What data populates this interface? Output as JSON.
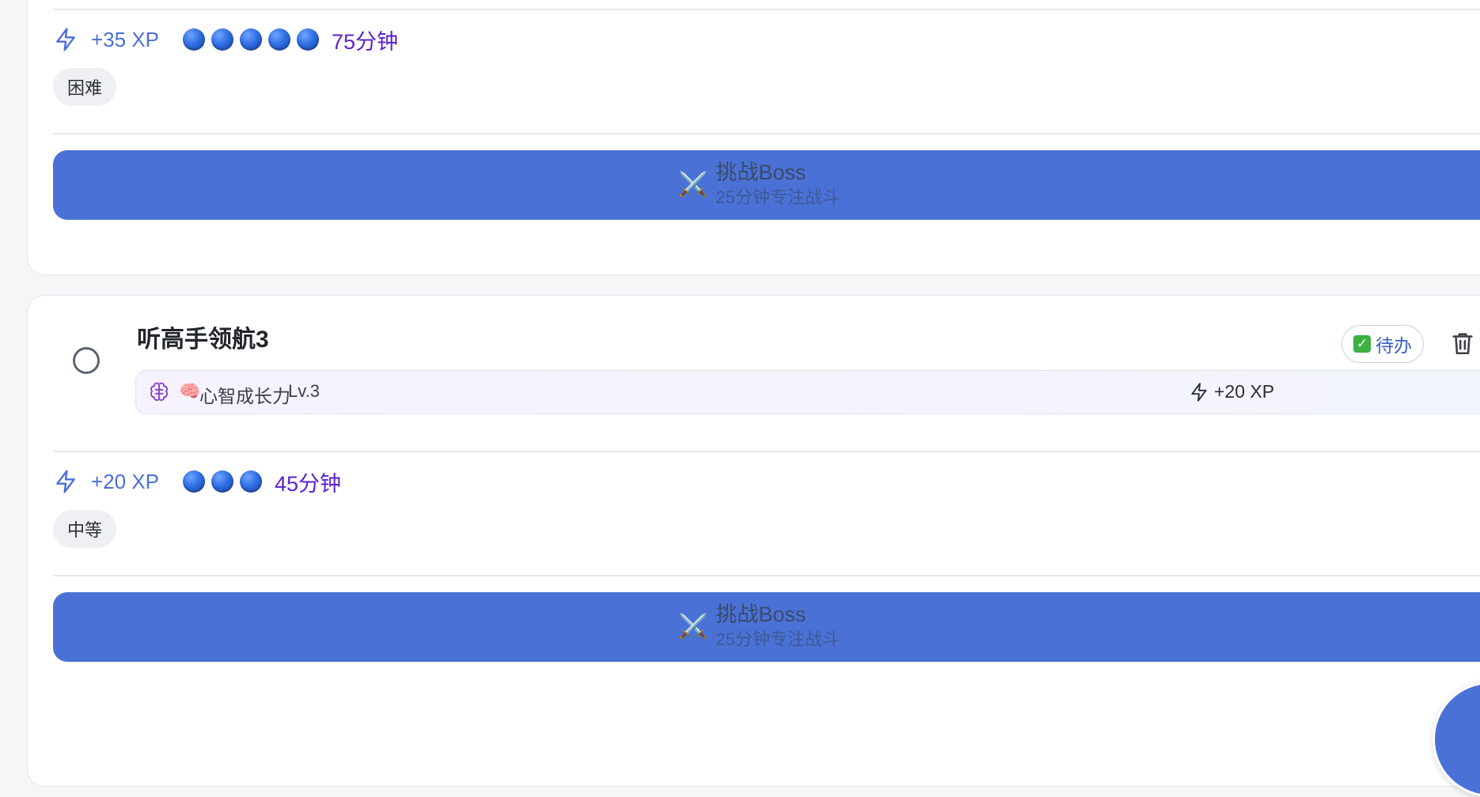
{
  "cards": [
    {
      "xp": "+35 XP",
      "dot_count": 5,
      "duration": "75分钟",
      "difficulty": "困难",
      "boss_button": {
        "title": "挑战Boss",
        "subtitle": "25分钟专注战斗",
        "icon": "⚔️"
      }
    },
    {
      "title": "听高手领航3",
      "status": "待办",
      "status_icon": "✅",
      "skill": {
        "emoji": "🧠",
        "name": "心智成长力",
        "level": "Lv.3",
        "xp": "+20 XP"
      },
      "xp": "+20 XP",
      "dot_count": 3,
      "duration": "45分钟",
      "difficulty": "中等",
      "boss_button": {
        "title": "挑战Boss",
        "subtitle": "25分钟专注战斗",
        "icon": "⚔️"
      }
    }
  ],
  "colors": {
    "accent": "#4a72d6",
    "xp": "#4a6fd8",
    "duration": "#5b1fd0",
    "skill_brain": "#8b3fd9"
  }
}
